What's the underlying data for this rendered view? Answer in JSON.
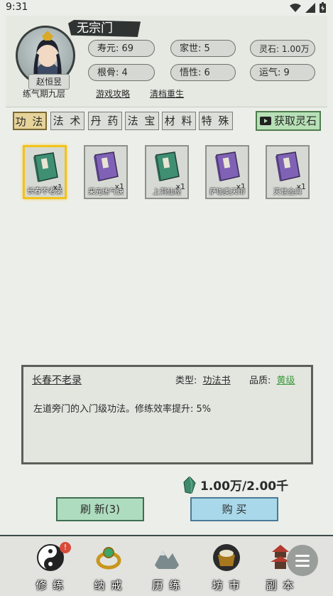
{
  "status_bar": {
    "time": "9:31"
  },
  "player": {
    "sect": "无宗门",
    "name": "赵恒昱",
    "realm": "练气期九层",
    "links": [
      "游戏攻略",
      "清档重生"
    ],
    "stats": [
      {
        "label": "寿元",
        "value": "69"
      },
      {
        "label": "家世",
        "value": "5"
      },
      {
        "label": "灵石",
        "value": "1.00万"
      },
      {
        "label": "根骨",
        "value": "4"
      },
      {
        "label": "悟性",
        "value": "6"
      },
      {
        "label": "运气",
        "value": "9"
      }
    ]
  },
  "tabs": [
    {
      "label": "功 法",
      "active": true
    },
    {
      "label": "法 术"
    },
    {
      "label": "丹 药"
    },
    {
      "label": "法 宝"
    },
    {
      "label": "材 料"
    },
    {
      "label": "特 殊"
    }
  ],
  "get_stones_label": "获取灵石",
  "items": [
    {
      "name": "长春不老录",
      "qty": "x1",
      "cover": "#3f8f73",
      "spine": "#2d6a55"
    },
    {
      "name": "采元练气诀",
      "qty": "x1",
      "cover": "#7f62b5",
      "spine": "#5d448c"
    },
    {
      "name": "上洞仙经",
      "qty": "x1",
      "cover": "#3f8f73",
      "spine": "#2d6a55"
    },
    {
      "name": "萨珈奥天印",
      "qty": "x1",
      "cover": "#7f62b5",
      "spine": "#5d448c"
    },
    {
      "name": "灭世金典",
      "qty": "x1",
      "cover": "#7f62b5",
      "spine": "#5d448c"
    }
  ],
  "detail": {
    "name": "长春不老录",
    "type_label": "类型:",
    "type_value": "功法书",
    "quality_label": "品质:",
    "quality_value": "黄级",
    "quality_color": "#3c9a3c",
    "description": "左道旁门的入门级功法。修练效率提升: 5%"
  },
  "price": "1.00万/2.00千",
  "buttons": {
    "refresh": "刷 新(3)",
    "buy": "购 买"
  },
  "nav": [
    {
      "label": "修 练",
      "badge": "!"
    },
    {
      "label": "纳 戒"
    },
    {
      "label": "历 练"
    },
    {
      "label": "坊 市"
    },
    {
      "label": "副 本"
    }
  ]
}
